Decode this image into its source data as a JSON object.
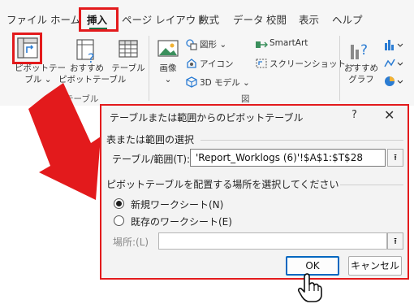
{
  "ribbon": {
    "tabs": [
      "ファイル",
      "ホーム",
      "挿入",
      "ページ レイアウト",
      "数式",
      "データ",
      "校閲",
      "表示",
      "ヘルプ"
    ],
    "active_tab": "挿入",
    "table_group": {
      "pivot_label_line1": "ピボットテー",
      "pivot_label_line2": "ブル ⌄",
      "recommended_line1": "おすすめ",
      "recommended_line2": "ピボットテーブル",
      "table_label": "テーブル",
      "group_label": "テーブル"
    },
    "illustrations_group": {
      "image_label": "画像",
      "image_arrow": "⌄",
      "shapes_label": "図形 ⌄",
      "icons_label": "アイコン",
      "models_label": "3D モデル ⌄",
      "smartart_label": "SmartArt",
      "screenshot_label": "スクリーンショット ⌄",
      "group_label": "図"
    },
    "charts_group": {
      "recommended_line1": "おすすめ",
      "recommended_line2": "グラフ"
    }
  },
  "dialog": {
    "title": "テーブルまたは範囲からのピボットテーブル",
    "help": "?",
    "close": "✕",
    "section1": "表または範囲の選択",
    "range_label": "テーブル/範囲(T):",
    "range_value": "'Report_Worklogs (6)'!$A$1:$T$28",
    "section2": "ピボットテーブルを配置する場所を選択してください",
    "option_new": "新規ワークシート(N)",
    "option_existing": "既存のワークシート(E)",
    "location_label": "場所:(L)",
    "ok": "OK",
    "cancel": "キャンセル"
  },
  "colors": {
    "highlight": "#e31a1c",
    "accent": "#0067c0",
    "excel_green": "#1e7145"
  }
}
